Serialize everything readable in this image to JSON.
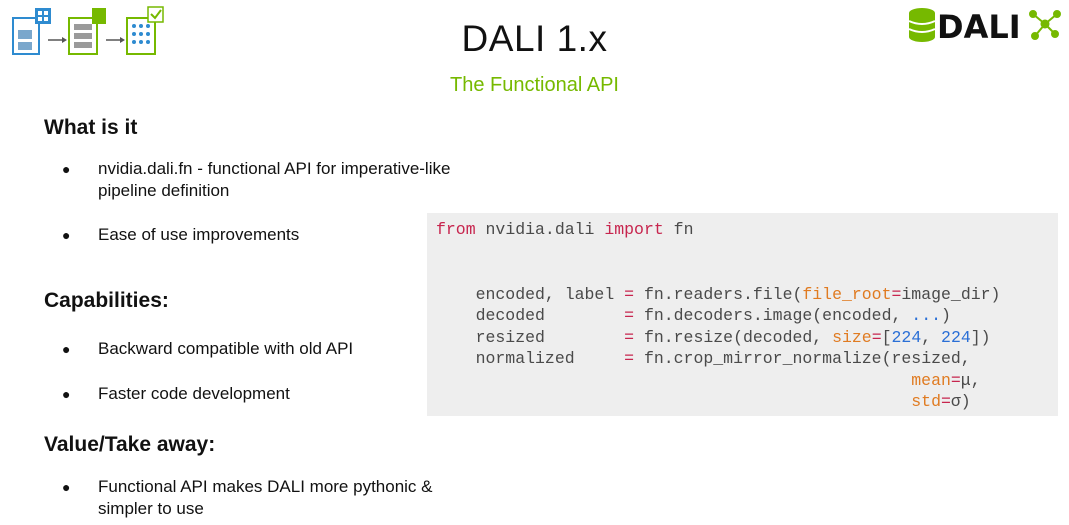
{
  "header": {
    "title": "DALI 1.x",
    "subtitle": "The Functional API",
    "logo_text": "DALI"
  },
  "sections": [
    {
      "heading": "What is it",
      "bullets": [
        "nvidia.dali.fn - functional API for imperative-like pipeline definition",
        "Ease of use improvements"
      ]
    },
    {
      "heading": "Capabilities:",
      "bullets": [
        "Backward compatible with old API",
        "Faster code development"
      ]
    },
    {
      "heading": "Value/Take away:",
      "bullets": [
        "Functional API makes DALI more pythonic & simpler to use"
      ]
    }
  ],
  "code": {
    "line1": {
      "kw_from": "from",
      "module": " nvidia.dali ",
      "kw_import": "import",
      "name": " fn"
    },
    "line2": {
      "lhs": "    encoded, label ",
      "eq": "=",
      "call": " fn.readers.file(",
      "arg": "file_root",
      "eq2": "=",
      "rest": "image_dir)"
    },
    "line3": {
      "lhs": "    decoded        ",
      "eq": "=",
      "call": " fn.decoders.image(encoded, ",
      "ellipsis": "...",
      "rest": ")"
    },
    "line4": {
      "lhs": "    resized        ",
      "eq": "=",
      "call": " fn.resize(decoded, ",
      "arg": "size",
      "eq2": "=",
      "open": "[",
      "n1": "224",
      "sep": ", ",
      "n2": "224",
      "rest": "])"
    },
    "line5": {
      "lhs": "    normalized     ",
      "eq": "=",
      "call": " fn.crop_mirror_normalize(resized,"
    },
    "line6": {
      "pad": "                                                ",
      "arg": "mean",
      "eq2": "=",
      "rest": "μ,"
    },
    "line7": {
      "pad": "                                                ",
      "arg": "std",
      "eq2": "=",
      "rest": "σ)"
    }
  },
  "colors": {
    "accent": "#76b900",
    "keyword": "#c7254e",
    "argument": "#e07b21",
    "number": "#2a6fd6"
  },
  "icons": [
    "image-file-icon",
    "arrow-icon",
    "table-file-icon",
    "arrow-icon",
    "tensor-file-icon",
    "dali-logo-icon"
  ]
}
